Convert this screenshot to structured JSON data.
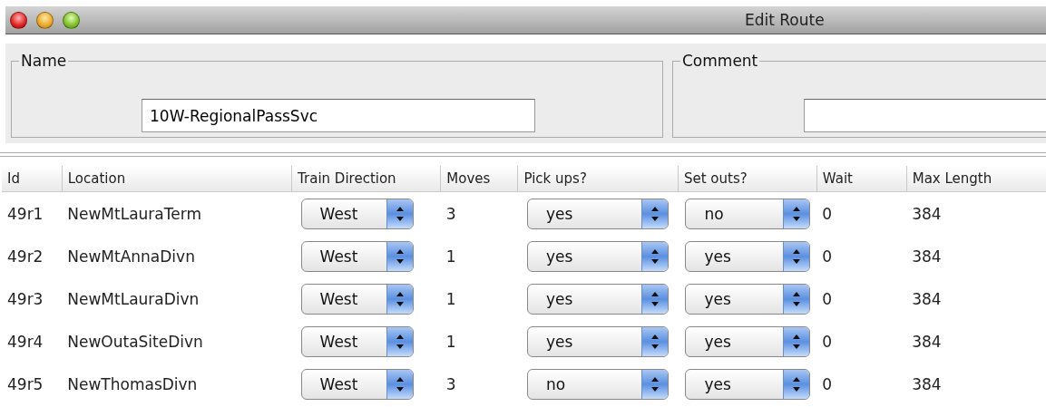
{
  "window": {
    "title": "Edit Route"
  },
  "name_panel": {
    "label": "Name",
    "value": "10W-RegionalPassSvc"
  },
  "comment_panel": {
    "label": "Comment"
  },
  "table": {
    "columns": [
      "Id",
      "Location",
      "Train Direction",
      "Moves",
      "Pick ups?",
      "Set outs?",
      "Wait",
      "Max Length"
    ],
    "rows": [
      {
        "id": "49r1",
        "location": "NewMtLauraTerm",
        "direction": "West",
        "moves": "3",
        "pick_ups": "yes",
        "set_outs": "no",
        "wait": "0",
        "max_length": "384"
      },
      {
        "id": "49r2",
        "location": "NewMtAnnaDivn",
        "direction": "West",
        "moves": "1",
        "pick_ups": "yes",
        "set_outs": "yes",
        "wait": "0",
        "max_length": "384"
      },
      {
        "id": "49r3",
        "location": "NewMtLauraDivn",
        "direction": "West",
        "moves": "1",
        "pick_ups": "yes",
        "set_outs": "yes",
        "wait": "0",
        "max_length": "384"
      },
      {
        "id": "49r4",
        "location": "NewOutaSiteDivn",
        "direction": "West",
        "moves": "1",
        "pick_ups": "yes",
        "set_outs": "yes",
        "wait": "0",
        "max_length": "384"
      },
      {
        "id": "49r5",
        "location": "NewThomasDivn",
        "direction": "West",
        "moves": "3",
        "pick_ups": "no",
        "set_outs": "yes",
        "wait": "0",
        "max_length": "384"
      }
    ]
  }
}
